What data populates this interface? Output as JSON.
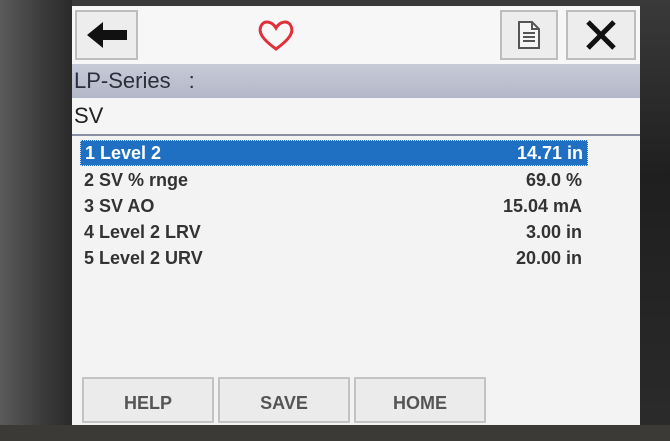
{
  "toolbar": {
    "back_icon": "back-arrow-icon",
    "favorite_icon": "heart-icon",
    "document_icon": "document-icon",
    "close_icon": "close-icon",
    "accent": "#e0303a"
  },
  "header": {
    "title": "LP-Series",
    "separator": ":",
    "subtitle": "SV"
  },
  "menu": {
    "items": [
      {
        "label": "1 Level 2",
        "value": "14.71 in",
        "selected": true
      },
      {
        "label": "2 SV % rnge",
        "value": "69.0 %",
        "selected": false
      },
      {
        "label": "3 SV AO",
        "value": "15.04 mA",
        "selected": false
      },
      {
        "label": "4 Level 2 LRV",
        "value": "3.00 in",
        "selected": false
      },
      {
        "label": "5 Level 2 URV",
        "value": "20.00 in",
        "selected": false
      }
    ],
    "selection_color": "#1f6fc2"
  },
  "softkeys": {
    "help": "HELP",
    "save": "SAVE",
    "home": "HOME"
  }
}
